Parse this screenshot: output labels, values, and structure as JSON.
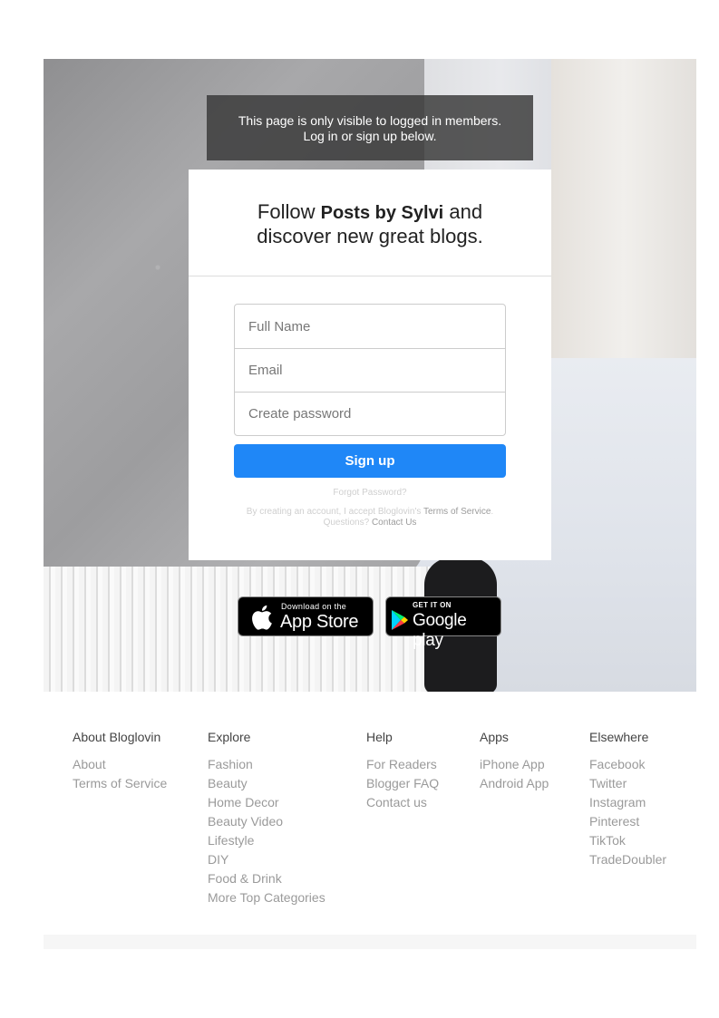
{
  "notice": {
    "line1": "This page is only visible to logged in members.",
    "line2": "Log in or sign up below."
  },
  "card": {
    "heading_pre": "Follow ",
    "heading_blog": "Posts by Sylvi",
    "heading_mid": " and",
    "heading_line2": "discover new great blogs.",
    "fullname_placeholder": "Full Name",
    "email_placeholder": "Email",
    "password_placeholder": "Create password",
    "signup_label": "Sign up",
    "forgot_label": "Forgot Password?",
    "legal_text": "By creating an account, I accept Bloglovin's ",
    "terms_link": "Terms of Service",
    "questions_text": ". Questions? ",
    "contact_link": "Contact Us"
  },
  "badges": {
    "apple_small": "Download on the",
    "apple_big": "App Store",
    "google_small": "GET IT ON",
    "google_big": "Google play"
  },
  "footer": {
    "columns": [
      {
        "title": "About Bloglovin",
        "links": [
          "About",
          "Terms of Service"
        ]
      },
      {
        "title": "Explore",
        "links": [
          "Fashion",
          "Beauty",
          "Home Decor",
          "Beauty Video",
          "Lifestyle",
          "DIY",
          "Food & Drink",
          "More Top Categories"
        ]
      },
      {
        "title": "Help",
        "links": [
          "For Readers",
          "Blogger FAQ",
          "Contact us"
        ]
      },
      {
        "title": "Apps",
        "links": [
          "iPhone App",
          "Android App"
        ]
      },
      {
        "title": "Elsewhere",
        "links": [
          "Facebook",
          "Twitter",
          "Instagram",
          "Pinterest",
          "TikTok",
          "TradeDoubler"
        ]
      }
    ]
  },
  "colors": {
    "accent": "#1f87f7",
    "notice_bg": "#373737",
    "link_gray": "#9a9a9a"
  }
}
